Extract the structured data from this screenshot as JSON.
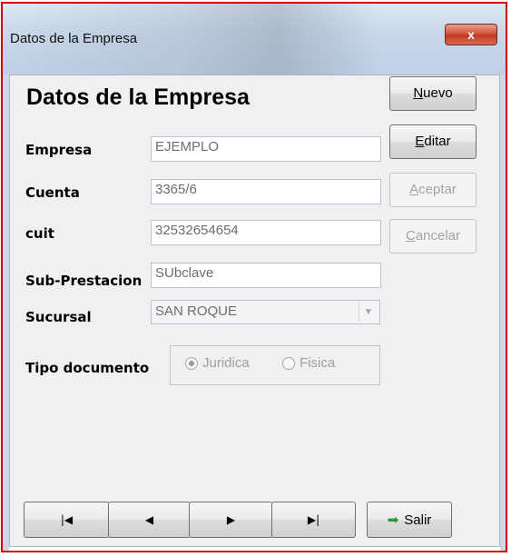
{
  "window": {
    "title": "Datos de la Empresa",
    "close_glyph": "x"
  },
  "form": {
    "heading": "Datos de la Empresa",
    "fields": {
      "empresa": {
        "label": "Empresa",
        "value": "EJEMPLO"
      },
      "cuenta": {
        "label": "Cuenta",
        "value": "3365/6"
      },
      "cuit": {
        "label": "cuit",
        "value": "32532654654"
      },
      "sub_prestacion": {
        "label": "Sub-Prestacion",
        "value": "SUbclave"
      },
      "sucursal": {
        "label": "Sucursal",
        "value": "SAN ROQUE"
      }
    },
    "tipo_documento": {
      "label": "Tipo documento",
      "options": [
        "Juridica",
        "Fisica"
      ],
      "selected": "Juridica"
    }
  },
  "buttons": {
    "nuevo": {
      "hotkey": "N",
      "rest": "uevo",
      "enabled": true
    },
    "editar": {
      "hotkey": "E",
      "rest": "ditar",
      "enabled": true
    },
    "aceptar": {
      "hotkey": "A",
      "rest": "ceptar",
      "enabled": false
    },
    "cancelar": {
      "hotkey": "C",
      "rest": "ancelar",
      "enabled": false
    }
  },
  "navigation": {
    "first": "|◀",
    "prev": "◀",
    "next": "▶",
    "last": "▶|",
    "salir": "Salir",
    "salir_icon": "arrow-right-icon",
    "salir_icon_color": "#2a9a2a"
  }
}
